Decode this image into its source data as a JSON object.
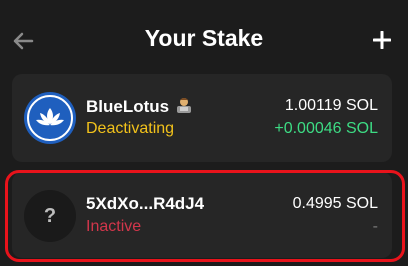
{
  "header": {
    "title": "Your Stake",
    "back_icon": "arrow-left-icon",
    "add_icon": "plus-icon"
  },
  "stakes": [
    {
      "name": "BlueLotus",
      "name_emoji": "technologist-emoji",
      "status": "Deactivating",
      "amount": "1.00119 SOL",
      "change": "+0.00046 SOL",
      "avatar": "lotus-icon"
    },
    {
      "name": "5XdXo...R4dJ4",
      "status": "Inactive",
      "amount": "0.4995 SOL",
      "change": "-",
      "avatar_text": "?"
    }
  ],
  "colors": {
    "background": "#1c1c1c",
    "card": "#262626",
    "deactivating": "#f2c21b",
    "inactive": "#d2364b",
    "positive": "#3ddc84",
    "highlight": "#e8131b",
    "lotus_bg": "#1f5fbe"
  }
}
